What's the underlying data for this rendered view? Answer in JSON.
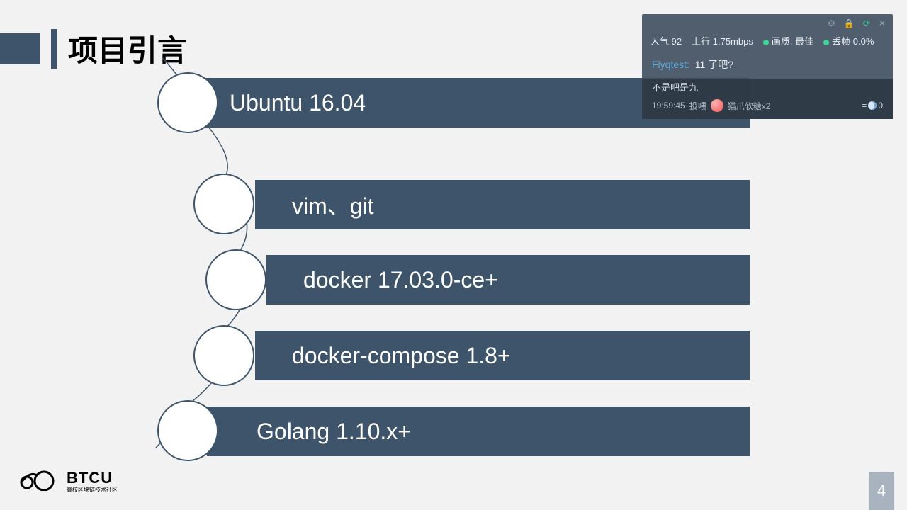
{
  "title": "项目引言",
  "items": [
    {
      "label": "Ubuntu 16.04"
    },
    {
      "label": "vim、git"
    },
    {
      "label": "docker 17.03.0-ce+"
    },
    {
      "label": "docker-compose 1.8+"
    },
    {
      "label": "Golang 1.10.x+"
    }
  ],
  "logo": {
    "name": "BTCU",
    "subtitle": "高校区块链技术社区"
  },
  "page": "4",
  "overlay": {
    "stats": {
      "popularity_label": "人气",
      "popularity": "92",
      "upload_label": "上行",
      "upload": "1.75mbps",
      "quality_label": "画质:",
      "quality": "最佳",
      "drop_label": "丢帧",
      "drop": "0.0%"
    },
    "chat": {
      "sender": "Flyqtest:",
      "message": "11 了吧?"
    },
    "danmu": "不是吧是九",
    "gift": {
      "time": "19:59:45",
      "action": "投喂",
      "item": "猫爪软糖x2",
      "count": "0"
    }
  }
}
